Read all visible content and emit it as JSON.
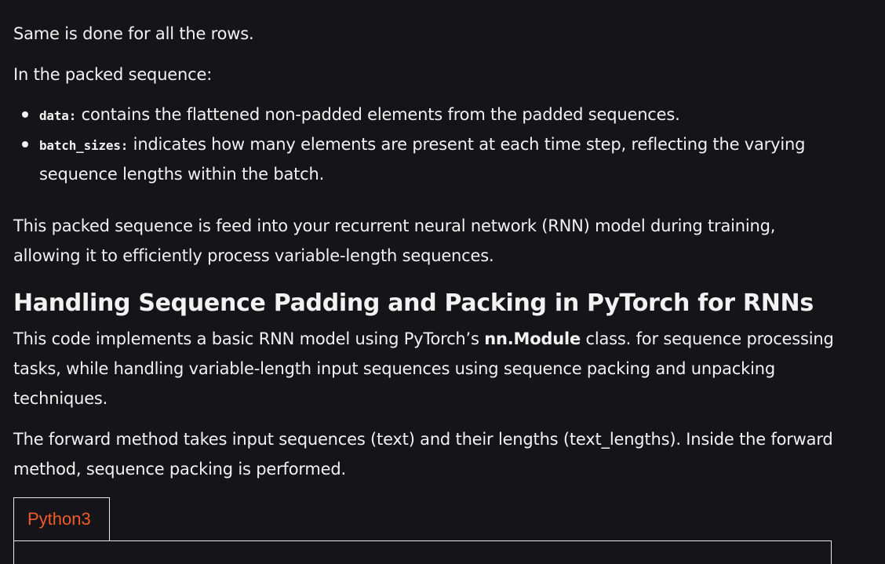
{
  "article": {
    "para_rows": "Same is done for all the rows.",
    "para_packed": "In the packed sequence:",
    "bullets": [
      {
        "code": "data:",
        "text": " contains the flattened non-padded elements from the padded sequences."
      },
      {
        "code": "batch_sizes:",
        "text": " indicates how many elements are present at each time step, reflecting the varying sequence lengths within the batch."
      }
    ],
    "para_feed": "This packed sequence is feed into your recurrent neural network (RNN) model during training, allowing it to efficiently process variable-length sequences.",
    "heading": "Handling Sequence Padding and Packing in PyTorch for RNNs",
    "para_impl_before": "This code implements a basic RNN model using PyTorch’s ",
    "para_impl_bold": "nn.Module",
    "para_impl_after": " class. for sequence processing tasks, while handling variable-length input sequences using sequence packing and unpacking techniques.",
    "para_forward": "The forward method takes input sequences (text) and their lengths (text_lengths). Inside the forward method, sequence packing is performed."
  },
  "code_tabs": {
    "active_tab": "Python3"
  },
  "colors": {
    "background": "#151519",
    "text": "#f2f2f2",
    "tab_accent": "#ef5b2a"
  }
}
